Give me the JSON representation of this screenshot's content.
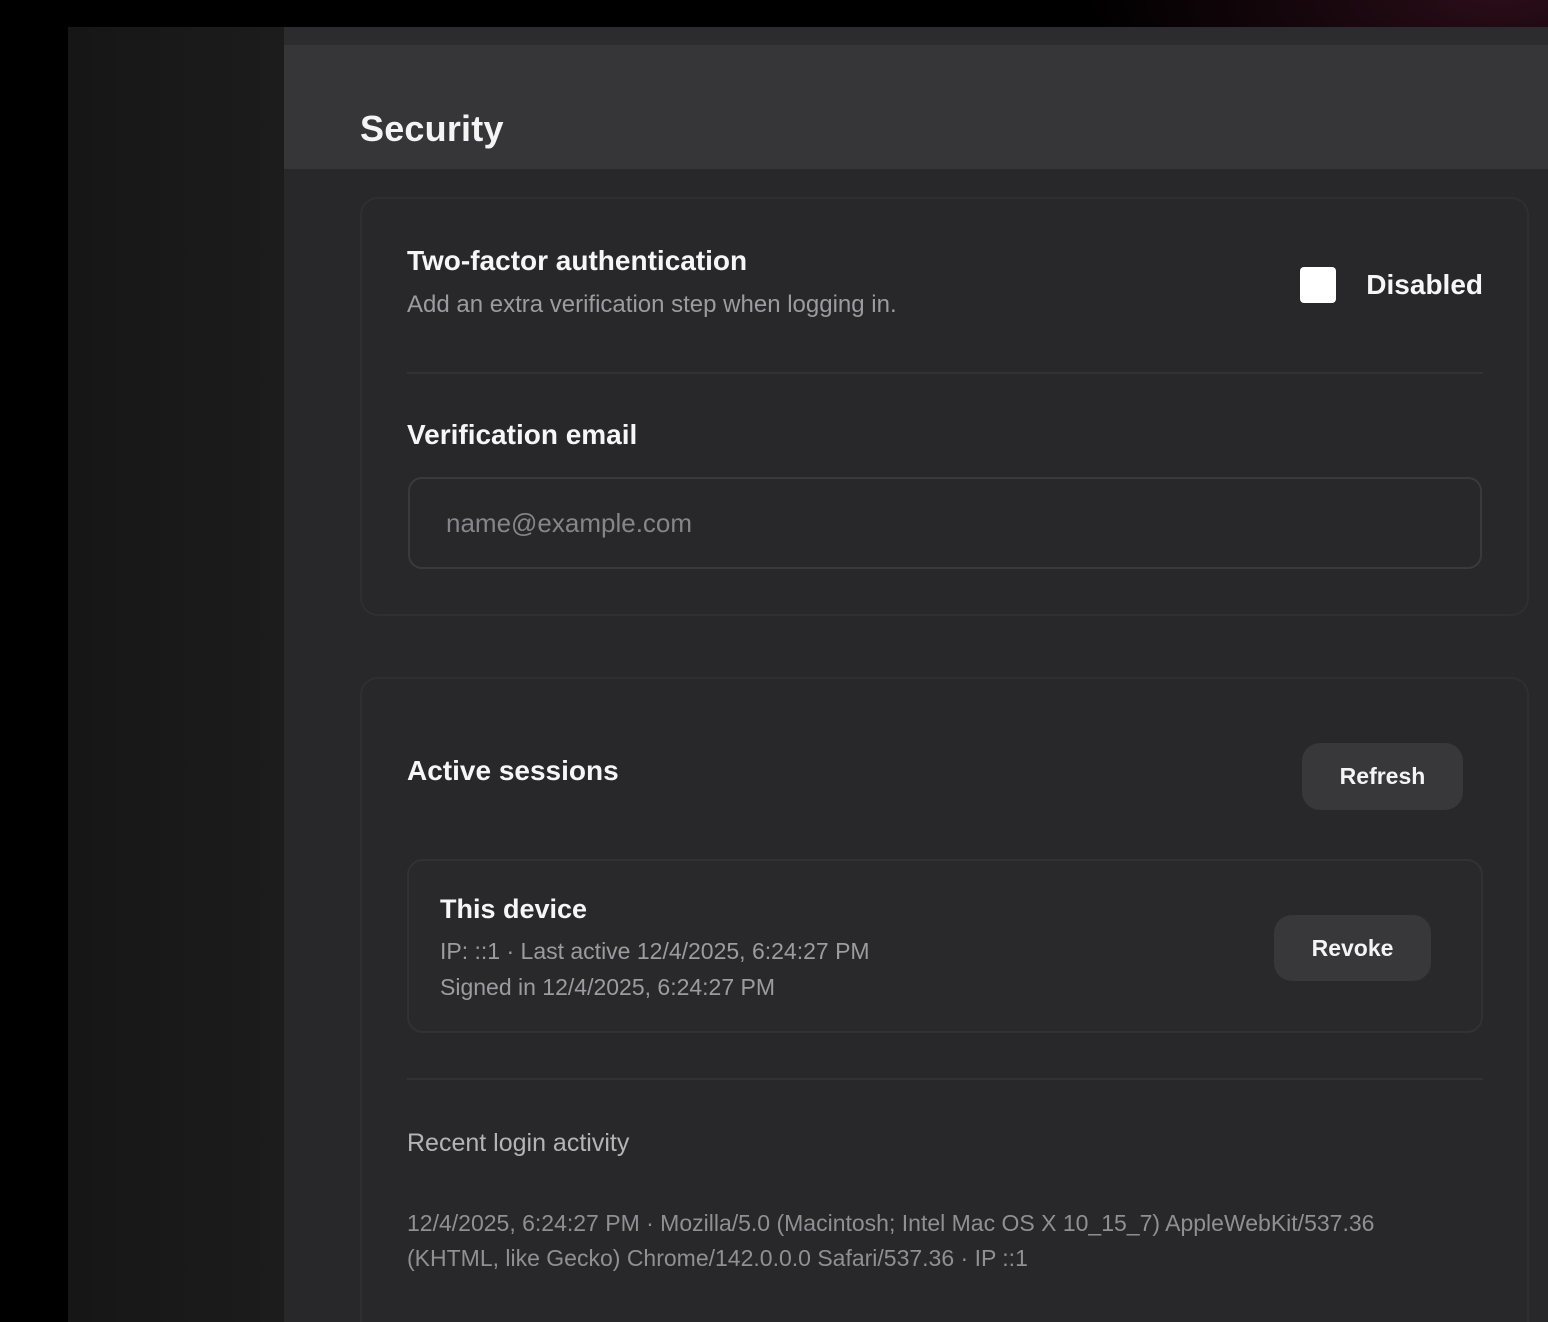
{
  "page": {
    "title": "Security"
  },
  "two_factor": {
    "title": "Two-factor authentication",
    "description": "Add an extra verification step when logging in.",
    "status_label": "Disabled",
    "enabled": false
  },
  "verification_email": {
    "label": "Verification email",
    "placeholder": "name@example.com",
    "value": ""
  },
  "sessions": {
    "title": "Active sessions",
    "refresh_label": "Refresh",
    "items": [
      {
        "name": "This device",
        "meta_line": "IP: ::1 · Last active 12/4/2025, 6:24:27 PM",
        "signed_in": "Signed in 12/4/2025, 6:24:27 PM",
        "revoke_label": "Revoke"
      }
    ]
  },
  "recent_activity": {
    "label": "Recent login activity",
    "entries": [
      "12/4/2025, 6:24:27 PM · Mozilla/5.0 (Macintosh; Intel Mac OS X 10_15_7) AppleWebKit/537.36 (KHTML, like Gecko) Chrome/142.0.0.0 Safari/537.36 · IP ::1"
    ]
  },
  "colors": {
    "background": "#000000",
    "sidebar": "#1b1b1c",
    "main": "#28282b",
    "header": "#363638",
    "button": "#38383b",
    "text_primary": "#f6f6f7",
    "text_secondary": "#9b9ba0"
  }
}
